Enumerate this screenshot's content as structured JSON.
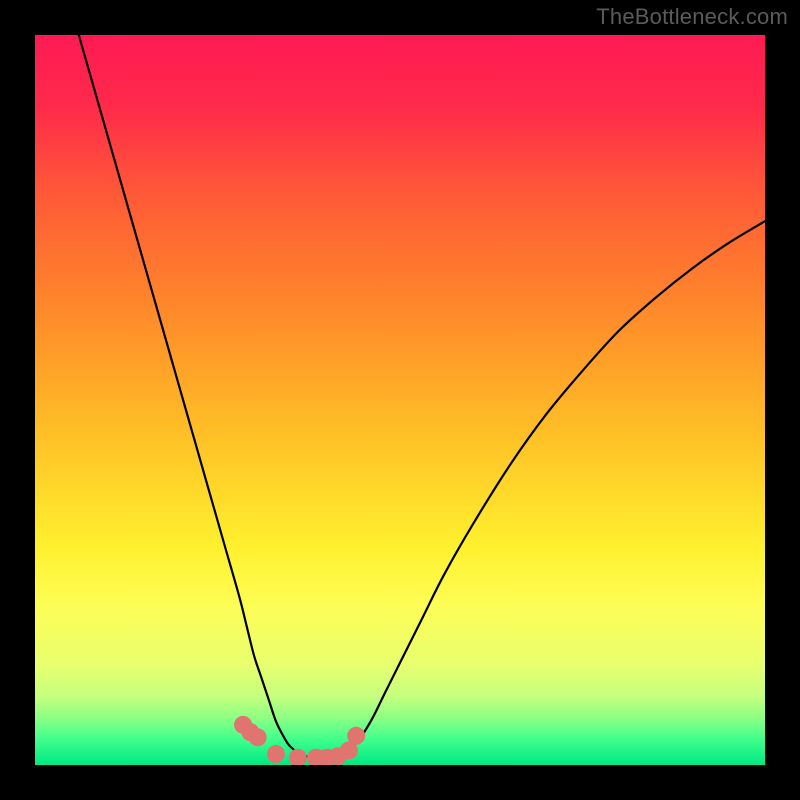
{
  "watermark": "TheBottleneck.com",
  "chart_data": {
    "type": "line",
    "title": "",
    "xlabel": "",
    "ylabel": "",
    "xlim": [
      0,
      100
    ],
    "ylim": [
      0,
      100
    ],
    "series": [
      {
        "name": "left-curve",
        "x": [
          6,
          8,
          10,
          12,
          14,
          16,
          18,
          20,
          22,
          24,
          26,
          28,
          29,
          30,
          31,
          32,
          33,
          34,
          35,
          37,
          40
        ],
        "y": [
          100,
          93,
          86,
          79,
          72,
          65,
          58,
          51,
          44,
          37,
          30,
          23,
          19,
          15,
          12,
          9,
          6,
          4,
          2.5,
          1.2,
          1
        ]
      },
      {
        "name": "right-curve",
        "x": [
          40,
          42,
          44,
          46,
          48,
          50,
          53,
          56,
          60,
          65,
          70,
          75,
          80,
          85,
          90,
          95,
          100
        ],
        "y": [
          1,
          1.5,
          3,
          6,
          10,
          14,
          20,
          26,
          33,
          41,
          48,
          54,
          59.5,
          64,
          68,
          71.5,
          74.5
        ]
      },
      {
        "name": "highlight-markers",
        "x": [
          28.5,
          29.5,
          30.5,
          33,
          36,
          38.5,
          40,
          41.5,
          43,
          44
        ],
        "y": [
          5.5,
          4.5,
          3.8,
          1.5,
          1,
          1,
          1,
          1.2,
          2,
          4
        ]
      }
    ],
    "gradient_stops": [
      {
        "pos": 0.0,
        "color": "#ff1a53"
      },
      {
        "pos": 0.1,
        "color": "#ff2b4a"
      },
      {
        "pos": 0.22,
        "color": "#ff5a37"
      },
      {
        "pos": 0.38,
        "color": "#ff8a2a"
      },
      {
        "pos": 0.55,
        "color": "#ffc126"
      },
      {
        "pos": 0.7,
        "color": "#fff02e"
      },
      {
        "pos": 0.78,
        "color": "#fdfd55"
      },
      {
        "pos": 0.86,
        "color": "#e9ff6e"
      },
      {
        "pos": 0.905,
        "color": "#c6ff7d"
      },
      {
        "pos": 0.935,
        "color": "#8dff84"
      },
      {
        "pos": 0.965,
        "color": "#3fff8c"
      },
      {
        "pos": 1.0,
        "color": "#00e884"
      }
    ],
    "marker_color": "#e0746f",
    "curve_color": "#000000"
  }
}
